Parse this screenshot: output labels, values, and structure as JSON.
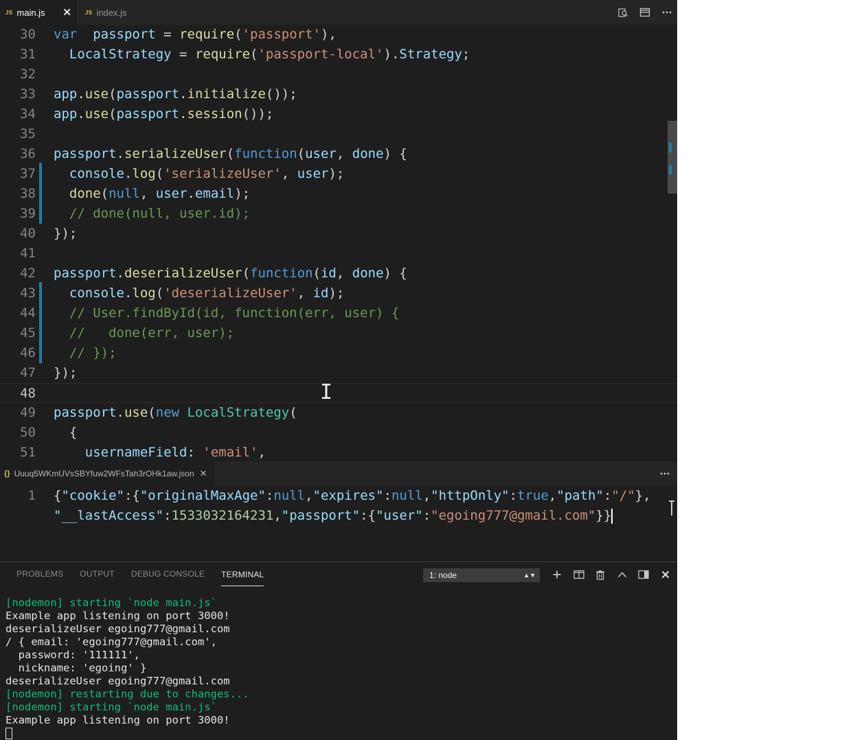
{
  "tabs": [
    {
      "lang": "JS",
      "name": "main.js",
      "active": true,
      "close": "✕"
    },
    {
      "lang": "JS",
      "name": "index.js",
      "active": false
    }
  ],
  "tab_actions": [
    "open-changes-icon",
    "split-editor-icon",
    "more-actions-icon"
  ],
  "editor": {
    "current_line": "48",
    "lines": [
      {
        "n": "30",
        "tokens": [
          [
            "kw",
            "var"
          ],
          [
            "",
            "  "
          ],
          [
            "var",
            "passport"
          ],
          [
            "",
            " = "
          ],
          [
            "fn",
            "require"
          ],
          [
            "",
            "("
          ],
          [
            "str",
            "'passport'"
          ],
          [
            "",
            "),"
          ]
        ]
      },
      {
        "n": "31",
        "tokens": [
          [
            "",
            "  "
          ],
          [
            "var",
            "LocalStrategy"
          ],
          [
            "",
            " = "
          ],
          [
            "fn",
            "require"
          ],
          [
            "",
            "("
          ],
          [
            "str",
            "'passport-local'"
          ],
          [
            "",
            ")."
          ],
          [
            "var",
            "Strategy"
          ],
          [
            "",
            ";"
          ]
        ]
      },
      {
        "n": "32",
        "tokens": []
      },
      {
        "n": "33",
        "tokens": [
          [
            "var",
            "app"
          ],
          [
            "",
            "."
          ],
          [
            "fn",
            "use"
          ],
          [
            "",
            "("
          ],
          [
            "var",
            "passport"
          ],
          [
            "",
            "."
          ],
          [
            "fn",
            "initialize"
          ],
          [
            "",
            "());"
          ]
        ]
      },
      {
        "n": "34",
        "tokens": [
          [
            "var",
            "app"
          ],
          [
            "",
            "."
          ],
          [
            "fn",
            "use"
          ],
          [
            "",
            "("
          ],
          [
            "var",
            "passport"
          ],
          [
            "",
            "."
          ],
          [
            "fn",
            "session"
          ],
          [
            "",
            "());"
          ]
        ]
      },
      {
        "n": "35",
        "tokens": []
      },
      {
        "n": "36",
        "tokens": [
          [
            "var",
            "passport"
          ],
          [
            "",
            "."
          ],
          [
            "fn",
            "serializeUser"
          ],
          [
            "",
            "("
          ],
          [
            "kw",
            "function"
          ],
          [
            "",
            "("
          ],
          [
            "var",
            "user"
          ],
          [
            "",
            ", "
          ],
          [
            "var",
            "done"
          ],
          [
            "",
            ") {"
          ]
        ]
      },
      {
        "n": "37",
        "tokens": [
          [
            "",
            "  "
          ],
          [
            "var",
            "console"
          ],
          [
            "",
            "."
          ],
          [
            "fn",
            "log"
          ],
          [
            "",
            "("
          ],
          [
            "str",
            "'serializeUser'"
          ],
          [
            "",
            ", "
          ],
          [
            "var",
            "user"
          ],
          [
            "",
            ");"
          ]
        ]
      },
      {
        "n": "38",
        "tokens": [
          [
            "",
            "  "
          ],
          [
            "fn",
            "done"
          ],
          [
            "",
            "("
          ],
          [
            "kw",
            "null"
          ],
          [
            "",
            ", "
          ],
          [
            "var",
            "user"
          ],
          [
            "",
            "."
          ],
          [
            "var",
            "email"
          ],
          [
            "",
            ");"
          ]
        ]
      },
      {
        "n": "39",
        "tokens": [
          [
            "",
            "  "
          ],
          [
            "cm",
            "// done(null, user.id);"
          ]
        ]
      },
      {
        "n": "40",
        "tokens": [
          [
            "",
            "});"
          ]
        ]
      },
      {
        "n": "41",
        "tokens": []
      },
      {
        "n": "42",
        "tokens": [
          [
            "var",
            "passport"
          ],
          [
            "",
            "."
          ],
          [
            "fn",
            "deserializeUser"
          ],
          [
            "",
            "("
          ],
          [
            "kw",
            "function"
          ],
          [
            "",
            "("
          ],
          [
            "var",
            "id"
          ],
          [
            "",
            ", "
          ],
          [
            "var",
            "done"
          ],
          [
            "",
            ") {"
          ]
        ]
      },
      {
        "n": "43",
        "tokens": [
          [
            "",
            "  "
          ],
          [
            "var",
            "console"
          ],
          [
            "",
            "."
          ],
          [
            "fn",
            "log"
          ],
          [
            "",
            "("
          ],
          [
            "str",
            "'deserializeUser'"
          ],
          [
            "",
            ", "
          ],
          [
            "var",
            "id"
          ],
          [
            "",
            ");"
          ]
        ]
      },
      {
        "n": "44",
        "tokens": [
          [
            "",
            "  "
          ],
          [
            "cm",
            "// User.findById(id, function(err, user) {"
          ]
        ]
      },
      {
        "n": "45",
        "tokens": [
          [
            "",
            "  "
          ],
          [
            "cm",
            "//   done(err, user);"
          ]
        ]
      },
      {
        "n": "46",
        "tokens": [
          [
            "",
            "  "
          ],
          [
            "cm",
            "// });"
          ]
        ]
      },
      {
        "n": "47",
        "tokens": [
          [
            "",
            "});"
          ]
        ]
      },
      {
        "n": "48",
        "tokens": []
      },
      {
        "n": "49",
        "tokens": [
          [
            "var",
            "passport"
          ],
          [
            "",
            "."
          ],
          [
            "fn",
            "use"
          ],
          [
            "",
            "("
          ],
          [
            "kw",
            "new"
          ],
          [
            "",
            ""
          ],
          [
            "",
            " "
          ],
          [
            "cls",
            "LocalStrategy"
          ],
          [
            "",
            "("
          ]
        ]
      },
      {
        "n": "50",
        "tokens": [
          [
            "",
            "  {"
          ]
        ]
      },
      {
        "n": "51",
        "tokens": [
          [
            "",
            "    "
          ],
          [
            "var",
            "usernameField"
          ],
          [
            "",
            ": "
          ],
          [
            "str",
            "'email'"
          ],
          [
            "",
            ","
          ]
        ]
      }
    ]
  },
  "json_editor": {
    "tab_name": "Uuuq5WKmUVsSBYfuw2WFsTah3rOHk1aw.json",
    "tab_icon": "{}",
    "close": "✕",
    "line_number": "1",
    "line1_tokens": [
      [
        "",
        "{"
      ],
      [
        "jkey",
        "\"cookie\""
      ],
      [
        "",
        ":{"
      ],
      [
        "jkey",
        "\"originalMaxAge\""
      ],
      [
        "",
        ":"
      ],
      [
        "jlit",
        "null"
      ],
      [
        "",
        ","
      ],
      [
        "jkey",
        "\"expires\""
      ],
      [
        "",
        ":"
      ],
      [
        "jlit",
        "null"
      ],
      [
        "",
        ","
      ],
      [
        "jkey",
        "\"httpOnly\""
      ],
      [
        "",
        ":"
      ],
      [
        "jlit",
        "true"
      ],
      [
        "",
        ","
      ],
      [
        "jkey",
        "\"path\""
      ],
      [
        "",
        ":"
      ],
      [
        "jstr",
        "\"/\""
      ],
      [
        "",
        "},"
      ]
    ],
    "line2_tokens": [
      [
        "jkey",
        "\"__lastAccess\""
      ],
      [
        "",
        ":"
      ],
      [
        "jnum",
        "1533032164231"
      ],
      [
        "",
        ","
      ],
      [
        "jkey",
        "\"passport\""
      ],
      [
        "",
        ":{"
      ],
      [
        "jkey",
        "\"user\""
      ],
      [
        "",
        ":"
      ],
      [
        "jstr",
        "\"egoing777@gmail.com\""
      ],
      [
        "",
        "}}"
      ]
    ]
  },
  "panel": {
    "tabs": [
      "PROBLEMS",
      "OUTPUT",
      "DEBUG CONSOLE",
      "TERMINAL"
    ],
    "active_tab": "TERMINAL",
    "terminal_select": "1: node",
    "actions": [
      "add-terminal-icon",
      "split-terminal-icon",
      "kill-terminal-icon",
      "maximize-panel-icon",
      "toggle-panel-position-icon",
      "close-panel-icon"
    ]
  },
  "terminal": {
    "lines": [
      {
        "text": "[nodemon] starting `node main.js`",
        "color": "green"
      },
      {
        "text": "Example app listening on port 3000!",
        "color": "white"
      },
      {
        "text": "deserializeUser egoing777@gmail.com",
        "color": "white"
      },
      {
        "text": "/ { email: 'egoing777@gmail.com',",
        "color": "white"
      },
      {
        "text": "  password: '111111',",
        "color": "white"
      },
      {
        "text": "  nickname: 'egoing' }",
        "color": "white"
      },
      {
        "text": "deserializeUser egoing777@gmail.com",
        "color": "white"
      },
      {
        "text": "[nodemon] restarting due to changes...",
        "color": "green"
      },
      {
        "text": "[nodemon] starting `node main.js`",
        "color": "green"
      },
      {
        "text": "Example app listening on port 3000!",
        "color": "white"
      }
    ]
  }
}
